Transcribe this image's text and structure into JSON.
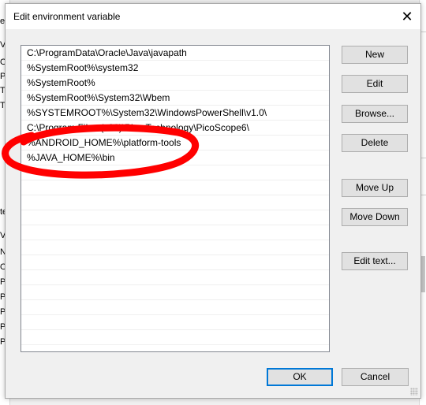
{
  "dialog": {
    "title": "Edit environment variable",
    "close_glyph": "✕"
  },
  "paths": [
    "C:\\ProgramData\\Oracle\\Java\\javapath",
    "%SystemRoot%\\system32",
    "%SystemRoot%",
    "%SystemRoot%\\System32\\Wbem",
    "%SYSTEMROOT%\\System32\\WindowsPowerShell\\v1.0\\",
    "C:\\Program Files (x86)\\Pico Technology\\PicoScope6\\",
    "%ANDROID_HOME%\\platform-tools",
    "%JAVA_HOME%\\bin"
  ],
  "buttons": {
    "new": "New",
    "edit": "Edit",
    "browse": "Browse...",
    "delete": "Delete",
    "move_up": "Move Up",
    "move_down": "Move Down",
    "edit_text": "Edit text...",
    "ok": "OK",
    "cancel": "Cancel"
  },
  "background_fragments": [
    "er",
    "Va",
    "Or",
    "Pa",
    "TE",
    "TM",
    "te",
    "Va",
    "NU",
    "OS",
    "Pa",
    "PA",
    "PF",
    "PF",
    "PF"
  ],
  "annotation": {
    "color": "#ff0000",
    "shape": "ellipse"
  }
}
